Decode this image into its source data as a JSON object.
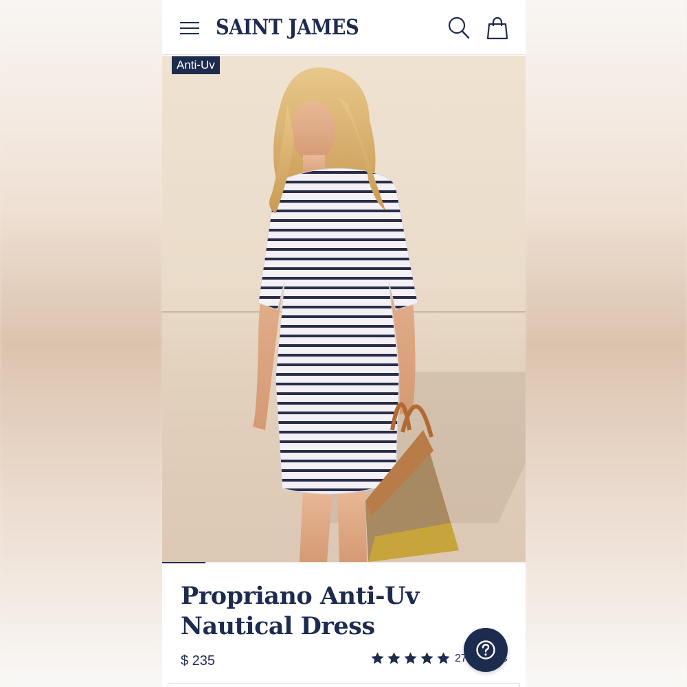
{
  "header": {
    "brand": "SAINT JAMES",
    "menu_icon": "hamburger-menu-icon",
    "search_icon": "search-icon",
    "bag_icon": "shopping-bag-icon"
  },
  "hero": {
    "badge": "Anti-Uv",
    "image_progress": 0.12
  },
  "product": {
    "title": "Propriano Anti-Uv Nautical Dress",
    "price": "$ 235",
    "rating": 5,
    "reviews_label": "27 reviews"
  },
  "help": {
    "icon": "question-mark-icon"
  },
  "colors": {
    "navy": "#1d2b4f",
    "background": "#ffffff"
  }
}
